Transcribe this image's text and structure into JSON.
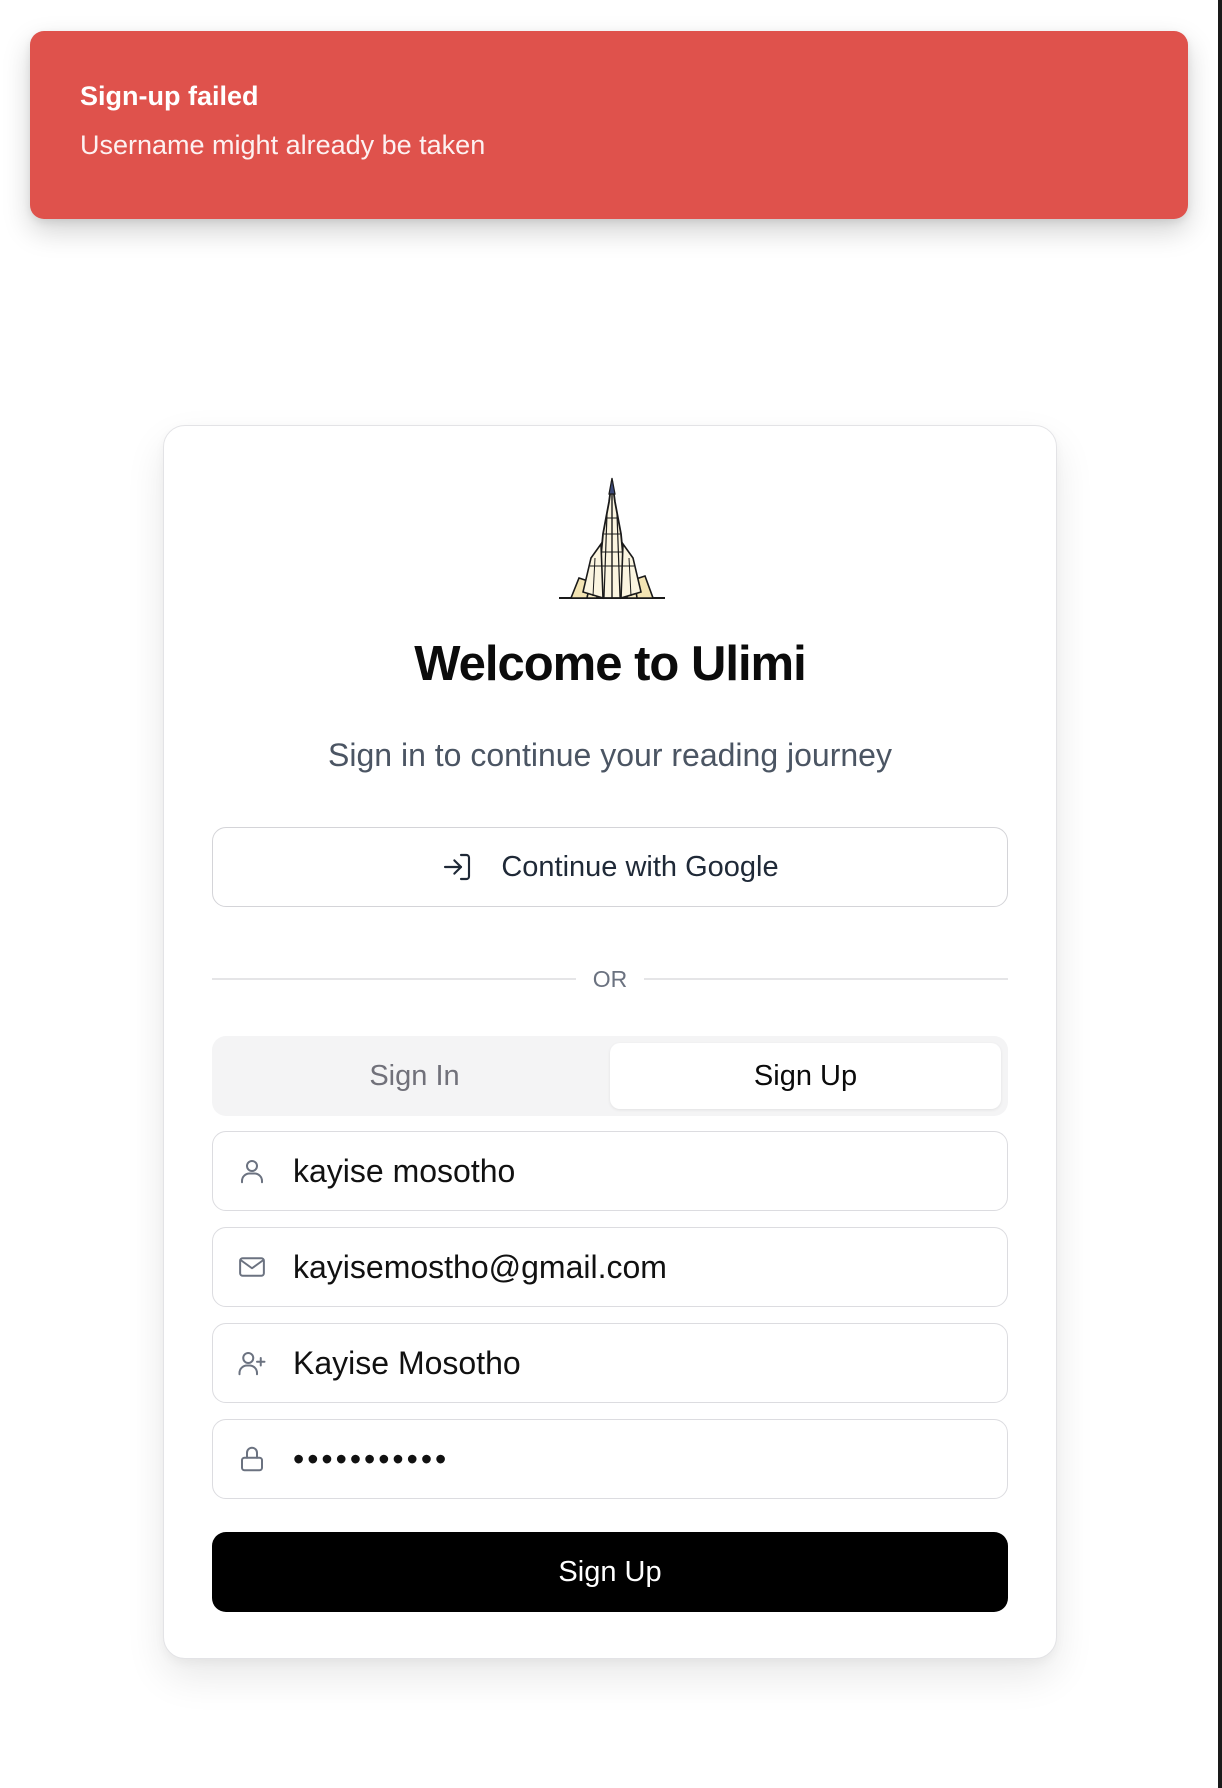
{
  "toast": {
    "title": "Sign-up failed",
    "description": "Username might already be taken",
    "color": "#df524c"
  },
  "card": {
    "logo_icon": "tower-illustration-icon",
    "title": "Welcome to Ulimi",
    "subtitle": "Sign in to continue your reading journey",
    "google_button_label": "Continue with Google",
    "divider_label": "OR",
    "tabs": [
      {
        "label": "Sign In",
        "active": false
      },
      {
        "label": "Sign Up",
        "active": true
      }
    ],
    "fields": {
      "username": {
        "icon": "user-icon",
        "value": "kayise mosotho"
      },
      "email": {
        "icon": "mail-icon",
        "value": "kayisemostho@gmail.com"
      },
      "display_name": {
        "icon": "user-plus-icon",
        "value": "Kayise Mosotho"
      },
      "password": {
        "icon": "lock-icon",
        "value": "•••••••••••"
      }
    },
    "submit_label": "Sign Up"
  }
}
